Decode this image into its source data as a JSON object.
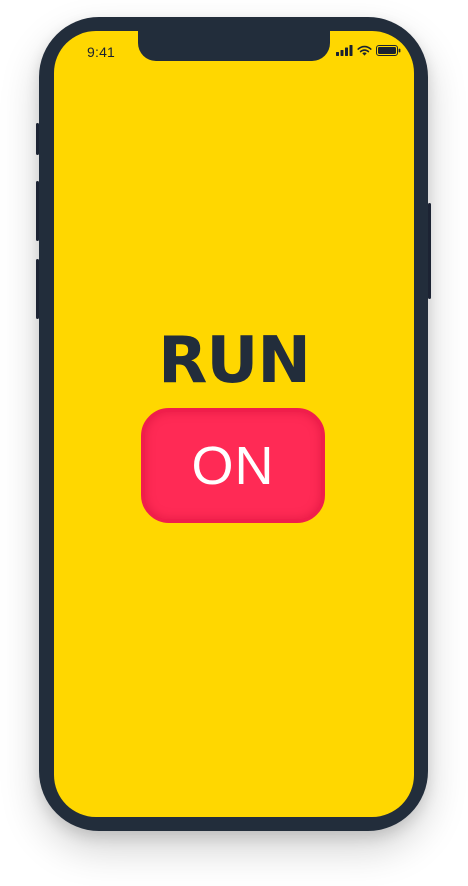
{
  "status_bar": {
    "time": "9:41",
    "icons": [
      "signal-icon",
      "wifi-icon",
      "battery-icon"
    ]
  },
  "main": {
    "title": "RUN",
    "toggle_label": "ON"
  },
  "colors": {
    "screen_background": "#ffd700",
    "device_frame": "#222d3b",
    "title_text": "#222d3b",
    "toggle_background": "#ff2a55",
    "toggle_text": "#ffffff"
  }
}
